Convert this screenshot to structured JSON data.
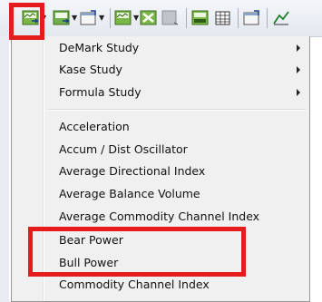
{
  "toolbar": {
    "buttons": [
      {
        "icon": "indicator-insert-icon"
      },
      {
        "icon": "study-insert-icon"
      },
      {
        "icon": "chart-properties-icon"
      },
      {
        "icon": "price-chart-icon"
      },
      {
        "icon": "close-chart-icon"
      },
      {
        "icon": "blank-chart-icon"
      },
      {
        "icon": "bar-chart-icon"
      },
      {
        "icon": "table-icon"
      },
      {
        "icon": "settings-icon"
      },
      {
        "icon": "trend-chart-icon"
      }
    ]
  },
  "menu": {
    "submenus": [
      {
        "label": "DeMark Study"
      },
      {
        "label": "Kase Study"
      },
      {
        "label": "Formula Study"
      }
    ],
    "items": [
      {
        "label": "Acceleration"
      },
      {
        "label": "Accum / Dist Oscillator"
      },
      {
        "label": "Average Directional Index"
      },
      {
        "label": "Average Balance Volume"
      },
      {
        "label": "Average Commodity Channel Index"
      },
      {
        "label": "Bear Power"
      },
      {
        "label": "Bull Power"
      },
      {
        "label": "Commodity Channel Index"
      }
    ]
  },
  "colors": {
    "highlight": "#e61b1b",
    "menu_background": "#f0f0f0",
    "toolbar_top": "#f4f6f9"
  }
}
